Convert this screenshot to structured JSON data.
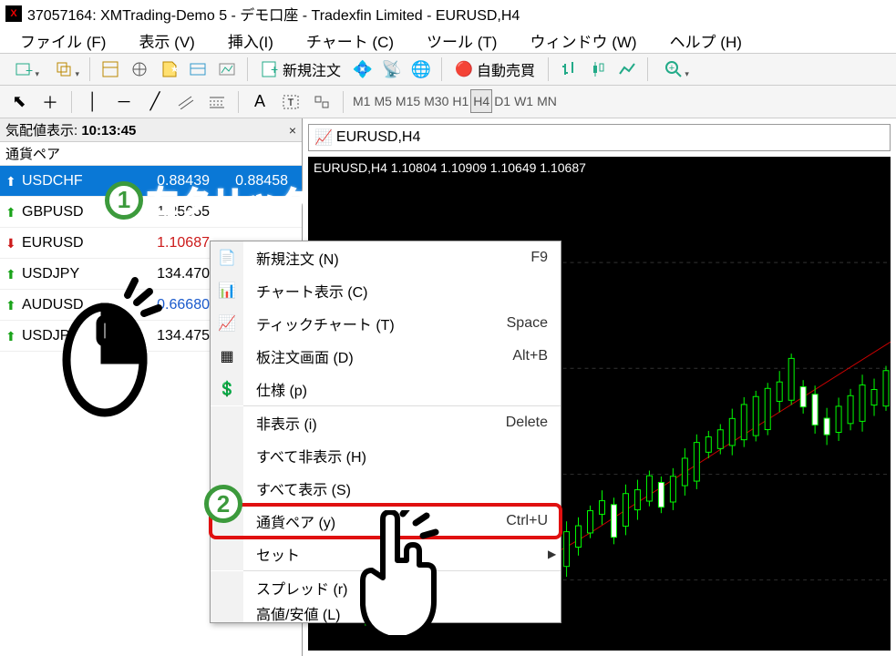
{
  "window_title": "37057164: XMTrading-Demo 5 - デモ口座 - Tradexfin Limited - EURUSD,H4",
  "menus": {
    "file": "ファイル (F)",
    "view": "表示 (V)",
    "insert": "挿入(I)",
    "chart": "チャート (C)",
    "tools": "ツール (T)",
    "window": "ウィンドウ (W)",
    "help": "ヘルプ (H)"
  },
  "toolbar": {
    "new_order": "新規注文",
    "auto_trade": "自動売買"
  },
  "timeframes": [
    "M1",
    "M5",
    "M15",
    "M30",
    "H1",
    "H4",
    "D1",
    "W1",
    "MN"
  ],
  "timeframe_active": "H4",
  "market_watch": {
    "title_prefix": "気配値表示:",
    "time": "10:13:45",
    "col_symbol": "通貨ペア",
    "rows": [
      {
        "dir": "up",
        "symbol": "USDCHF",
        "bid": "0.88439",
        "ask": "0.88458",
        "selected": true
      },
      {
        "dir": "up",
        "symbol": "GBPUSD",
        "bid": "1.25655",
        "ask": "",
        "red": false
      },
      {
        "dir": "down",
        "symbol": "EURUSD",
        "bid": "1.10687",
        "ask": "",
        "red": true
      },
      {
        "dir": "up",
        "symbol": "USDJPY",
        "bid": "134.470",
        "ask": ""
      },
      {
        "dir": "up",
        "symbol": "AUDUSD",
        "bid": "0.66680",
        "ask": "",
        "blue": true
      },
      {
        "dir": "up",
        "symbol": "USDJPY#",
        "bid": "134.475",
        "ask": ""
      }
    ]
  },
  "chart": {
    "tab_title": "EURUSD,H4",
    "ohlc": "EURUSD,H4 1.10804 1.10909 1.10649 1.10687"
  },
  "context_menu": [
    {
      "icon": "order",
      "label": "新規注文 (N)",
      "shortcut": "F9"
    },
    {
      "icon": "chart",
      "label": "チャート表示 (C)",
      "shortcut": ""
    },
    {
      "icon": "tick",
      "label": "ティックチャート (T)",
      "shortcut": "Space"
    },
    {
      "icon": "depth",
      "label": "板注文画面 (D)",
      "shortcut": "Alt+B"
    },
    {
      "icon": "spec",
      "label": "仕様 (p)",
      "shortcut": ""
    },
    {
      "sep": true
    },
    {
      "icon": "",
      "label": "非表示 (i)",
      "shortcut": "Delete"
    },
    {
      "icon": "",
      "label": "すべて非表示 (H)",
      "shortcut": ""
    },
    {
      "icon": "",
      "label": "すべて表示 (S)",
      "shortcut": ""
    },
    {
      "icon": "",
      "label": "通貨ペア (y)",
      "shortcut": "Ctrl+U",
      "highlight": true
    },
    {
      "icon": "",
      "label": "セット",
      "shortcut": "",
      "submenu": true
    },
    {
      "sep": true
    },
    {
      "icon": "",
      "label": "スプレッド (r)",
      "shortcut": ""
    },
    {
      "icon": "",
      "label": "高値/安値 (L)",
      "shortcut": "",
      "cut": true
    }
  ],
  "annot": {
    "step1_num": "1",
    "step1_text": "右クリック",
    "step2_num": "2"
  }
}
